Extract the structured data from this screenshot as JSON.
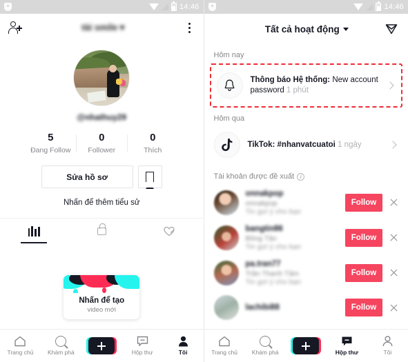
{
  "statusbar": {
    "time": "14:46",
    "icons": [
      "shield-icon",
      "wifi-icon",
      "signal-icon",
      "battery-icon"
    ]
  },
  "left_panel": {
    "header": {
      "title": "tài smile ▾",
      "add_user_icon": "add-user-icon",
      "more_icon": "kebab-menu-icon"
    },
    "profile": {
      "handle": "@nhathuy29",
      "stats": [
        {
          "num": "5",
          "label": "Đang Follow"
        },
        {
          "num": "0",
          "label": "Follower"
        },
        {
          "num": "0",
          "label": "Thích"
        }
      ],
      "edit_button": "Sửa hồ sơ",
      "bookmark_icon": "bookmark-icon",
      "bio_prompt": "Nhấn để thêm tiểu sử",
      "tabs": [
        {
          "icon": "grid-posts-icon",
          "active": true
        },
        {
          "icon": "lock-private-icon",
          "active": false
        },
        {
          "icon": "heart-liked-hidden-icon",
          "active": false
        }
      ]
    },
    "create_card": {
      "line1": "Nhấn để tạo",
      "line2": "video mới"
    },
    "bottom_nav": [
      {
        "label": "Trang chủ",
        "icon": "home-icon",
        "active": false
      },
      {
        "label": "Khám phá",
        "icon": "search-icon",
        "active": false
      },
      {
        "label": "",
        "icon": "create-plus-icon",
        "active": false
      },
      {
        "label": "Hộp thư",
        "icon": "inbox-icon",
        "active": false
      },
      {
        "label": "Tôi",
        "icon": "profile-person-icon",
        "active": true
      }
    ]
  },
  "right_panel": {
    "header": {
      "title": "Tất cả hoạt động",
      "caret_icon": "chevron-down-icon",
      "send_icon": "send-message-icon"
    },
    "sections": {
      "today_label": "Hôm nay",
      "yesterday_label": "Hôm qua",
      "suggested_label": "Tài khoản được đề xuất",
      "suggested_info_icon": "info-icon"
    },
    "today_notification": {
      "icon": "bell-icon",
      "title": "Thông báo Hệ thống: New account password",
      "title_bold": "Thông báo Hệ thống:",
      "title_rest": " New account password",
      "time": "1 phút",
      "chevron_icon": "chevron-right-icon",
      "highlight_color": "#ee2b34"
    },
    "yesterday_notification": {
      "icon": "tiktok-note-icon",
      "title_bold": "TikTok: #nhanvatcuatoi",
      "time": "1 ngày",
      "chevron_icon": "chevron-right-icon"
    },
    "suggested_accounts": [
      {
        "name": "onnakpop",
        "sub1": "onnakpop",
        "sub2": "Tin gợi ý cho bạn",
        "follow_label": "Follow",
        "close_icon": "close-icon"
      },
      {
        "name": "bangtin86",
        "sub1": "Bông Tân",
        "sub2": "Tin gợi ý cho bạn",
        "follow_label": "Follow",
        "close_icon": "close-icon"
      },
      {
        "name": "pa.tran77",
        "sub1": "Trần Thanh Tâm",
        "sub2": "Tin gợi ý cho bạn",
        "follow_label": "Follow",
        "close_icon": "close-icon"
      },
      {
        "name": "lachibi88",
        "sub1": "",
        "sub2": "",
        "follow_label": "Follow",
        "close_icon": "close-icon"
      }
    ],
    "bottom_nav": [
      {
        "label": "Trang chủ",
        "icon": "home-icon",
        "active": false
      },
      {
        "label": "Khám phá",
        "icon": "search-icon",
        "active": false
      },
      {
        "label": "",
        "icon": "create-plus-icon",
        "active": false
      },
      {
        "label": "Hộp thư",
        "icon": "inbox-icon",
        "active": true
      },
      {
        "label": "Tôi",
        "icon": "profile-person-icon",
        "active": false
      }
    ]
  },
  "colors": {
    "accent_red": "#F5455F",
    "highlight": "#ee2b34",
    "tiktok_cyan": "#25F4EE",
    "tiktok_red": "#FE2C55",
    "text": "#161823",
    "muted": "#86878b"
  }
}
